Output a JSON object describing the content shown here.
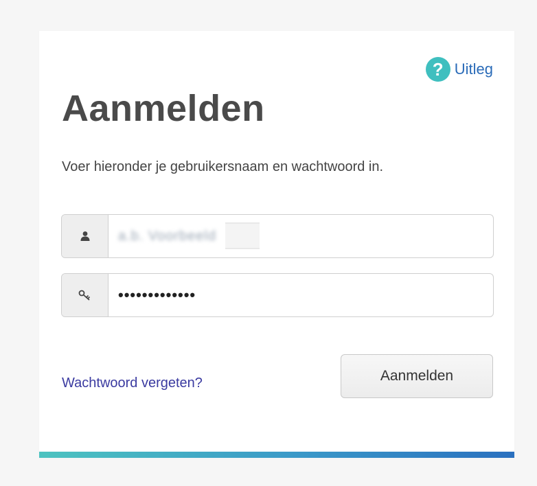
{
  "help": {
    "icon": "question-circle-icon",
    "icon_glyph": "?",
    "label": "Uitleg",
    "color": "#3fbfbf"
  },
  "login": {
    "title": "Aanmelden",
    "instruction": "Voer hieronder je gebruikersnaam en wachtwoord in.",
    "username": {
      "icon": "user-icon",
      "value_redacted": "a.b. Voorbeeld"
    },
    "password": {
      "icon": "key-icon",
      "masked_value": "•••••••••••••"
    },
    "forgot_link": "Wachtwoord vergeten?",
    "submit_label": "Aanmelden"
  },
  "colors": {
    "bar_gradient_start": "#4cc3c0",
    "bar_gradient_end": "#2a70bf",
    "link": "#3a3aa0"
  }
}
